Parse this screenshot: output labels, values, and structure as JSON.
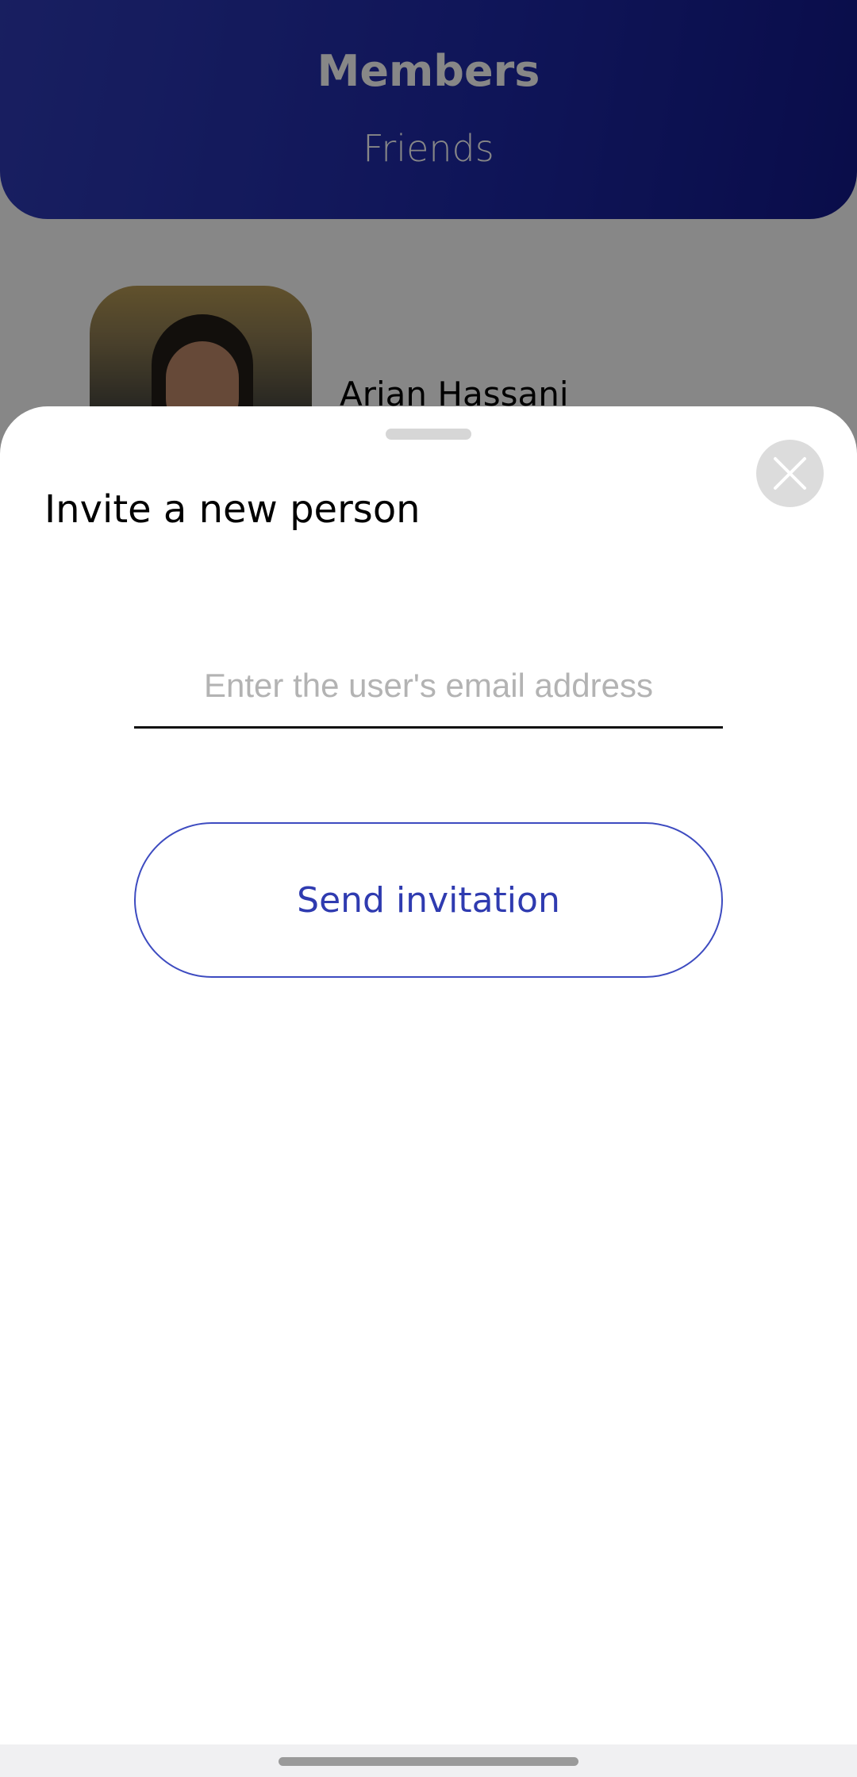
{
  "background_page": {
    "header": {
      "title": "Members",
      "subtitle": "Friends",
      "gradient_colors": [
        "#2f3bb6",
        "#13198c"
      ]
    },
    "members": [
      {
        "name": "Arian Hassani",
        "avatar_icon": "profile-photo"
      }
    ]
  },
  "sheet": {
    "title": "Invite a new person",
    "email_input": {
      "value": "",
      "placeholder": "Enter the user's email address"
    },
    "send_button_label": "Send invitation",
    "close_icon": "close-icon",
    "accent_color": "#2f3bb0"
  },
  "system": {
    "nav_bar_color": "#f0f0f2"
  }
}
